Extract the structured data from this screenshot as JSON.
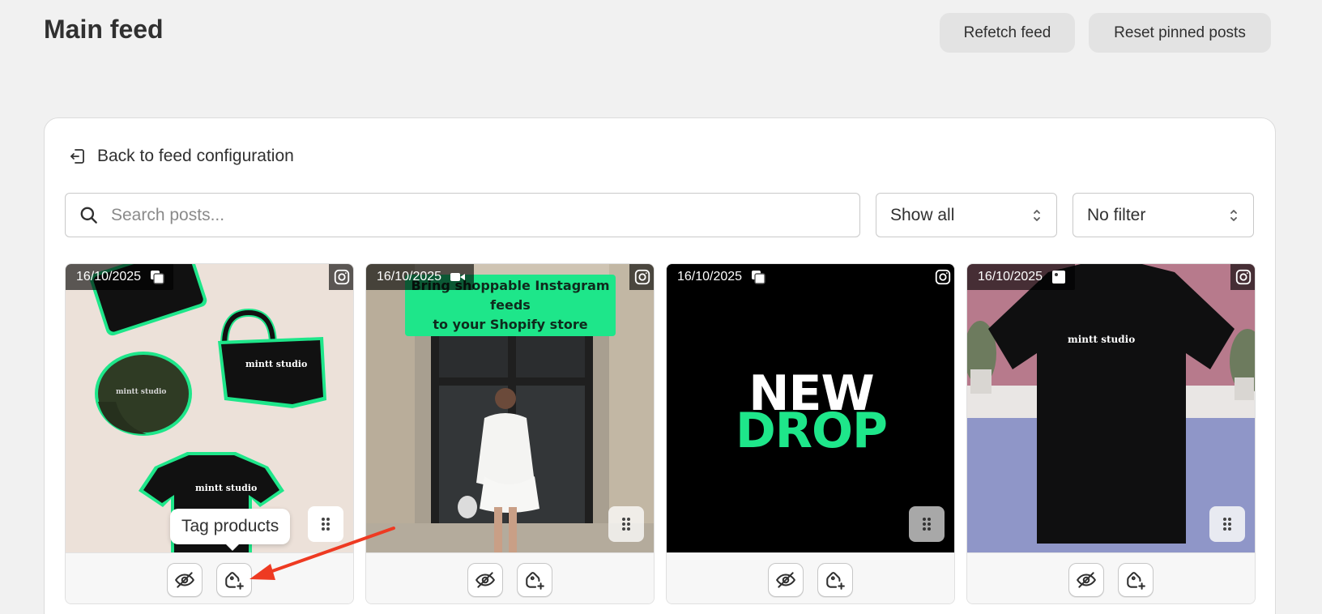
{
  "header": {
    "title": "Main feed",
    "refetch_label": "Refetch feed",
    "reset_label": "Reset pinned posts"
  },
  "back": {
    "label": "Back to feed configuration"
  },
  "search": {
    "placeholder": "Search posts...",
    "value": ""
  },
  "filters": {
    "show": "Show all",
    "filter": "No filter"
  },
  "posts": [
    {
      "date": "16/10/2025",
      "media_icon": "carousel-icon",
      "brand": "mintt studio"
    },
    {
      "date": "16/10/2025",
      "media_icon": "video-icon",
      "overlay_line1": "Bring shoppable Instagram feeds",
      "overlay_line2": "to your Shopify store"
    },
    {
      "date": "16/10/2025",
      "media_icon": "carousel-icon",
      "headline1": "NEW",
      "headline2": "DROP"
    },
    {
      "date": "16/10/2025",
      "media_icon": "image-icon",
      "brand": "mintt studio"
    }
  ],
  "tooltip": {
    "label": "Tag products"
  },
  "colors": {
    "accent_green": "#1ee68a",
    "arrow_red": "#ee3a22"
  }
}
